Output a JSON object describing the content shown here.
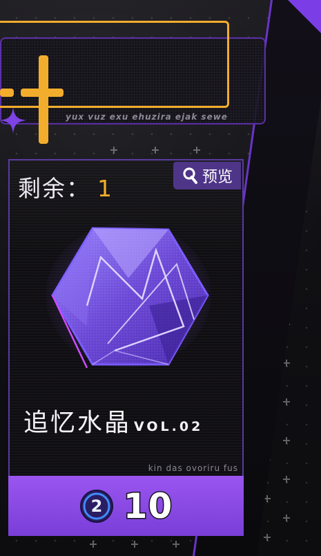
{
  "banner": {
    "subtext": "yux vuz exu ehuzira ejak sewe"
  },
  "card": {
    "remaining_label": "剩余：",
    "remaining_count": "1",
    "preview_label": "预览",
    "item_name": "追忆水晶",
    "item_vol": "VOL.02",
    "subtext": "kin das ovoriru fus",
    "price": "10",
    "currency_glyph": "2"
  },
  "icons": {
    "preview": "magnifier-icon",
    "currency": "coin-2-icon",
    "crystal": "crystal-gem-icon",
    "star": "four-point-star-icon"
  },
  "colors": {
    "accent_gold": "#f3ad2d",
    "accent_purple": "#7a3ed8",
    "panel_border": "#5a3aa0"
  }
}
